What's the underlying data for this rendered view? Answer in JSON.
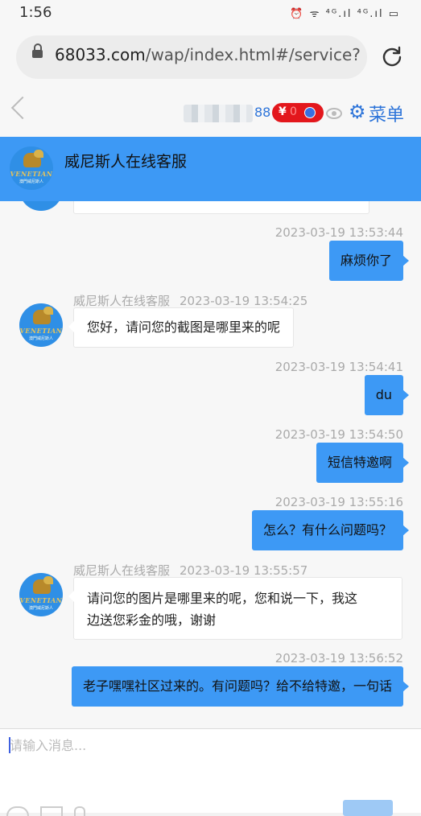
{
  "status_bar": {
    "time": "1:56",
    "icons": "⏰ ᯤ ⁴ᴳ.ıl ⁴ᴳ.ıl ▭"
  },
  "browser": {
    "url_domain": "68033.com",
    "url_path": "/wap/index.html#/service?u"
  },
  "nav": {
    "account_suffix": "88",
    "balance_currency": "¥",
    "balance_value": "0",
    "menu_label": "菜单"
  },
  "chat": {
    "header_title": "威尼斯人在线客服",
    "logo_text": "VENETIAN",
    "logo_subtext": "澳門威尼斯人",
    "messages": [
      {
        "direction": "out",
        "time": "2023-03-19 13:53:44",
        "text": "麻烦你了"
      },
      {
        "direction": "in",
        "sender": "威尼斯人在线客服",
        "time": "2023-03-19 13:54:25",
        "text": "您好，请问您的截图是哪里来的呢"
      },
      {
        "direction": "out",
        "time": "2023-03-19 13:54:41",
        "text": "du"
      },
      {
        "direction": "out",
        "time": "2023-03-19 13:54:50",
        "text": "短信特邀啊"
      },
      {
        "direction": "out",
        "time": "2023-03-19 13:55:16",
        "text": "怎么？有什么问题吗？"
      },
      {
        "direction": "in",
        "sender": "威尼斯人在线客服",
        "time": "2023-03-19 13:55:57",
        "text_line1": "请问您的图片是哪里来的呢，您和说一下，我这",
        "text_line2": "边送您彩金的哦，谢谢"
      },
      {
        "direction": "out",
        "time": "2023-03-19 13:56:52",
        "text": "老子嘿嘿社区过来的。有问题吗？给不给特邀，一句话"
      }
    ]
  },
  "input": {
    "placeholder": "请输入消息..."
  }
}
